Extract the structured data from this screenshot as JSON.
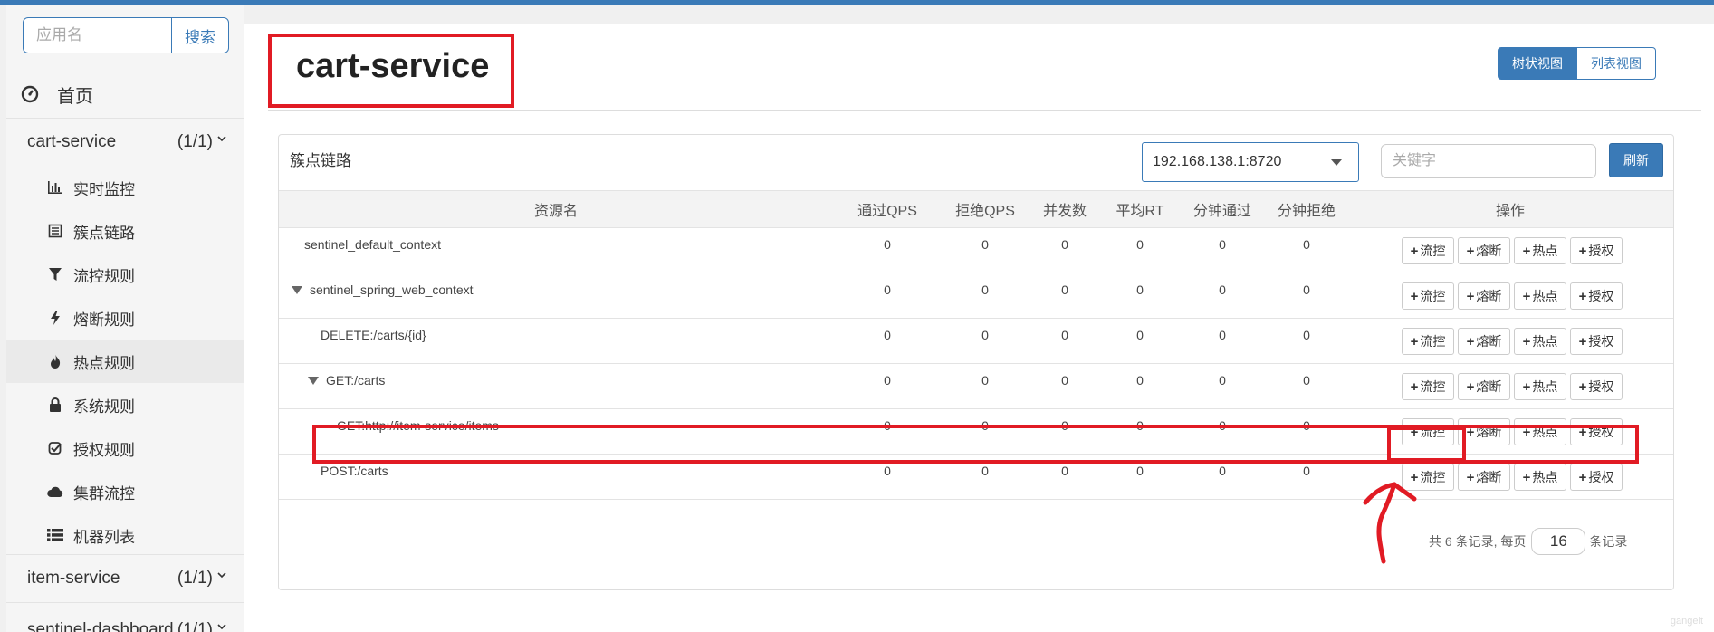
{
  "sidebar": {
    "search_placeholder": "应用名",
    "search_button": "搜索",
    "home_label": "首页",
    "apps": [
      {
        "name": "cart-service",
        "count": "(1/1)"
      },
      {
        "name": "item-service",
        "count": "(1/1)"
      },
      {
        "name": "sentinel-dashboard",
        "count": "(1/1)"
      }
    ],
    "menu": [
      {
        "label": "实时监控",
        "icon": "bar-chart-icon"
      },
      {
        "label": "簇点链路",
        "icon": "list-icon"
      },
      {
        "label": "流控规则",
        "icon": "filter-icon"
      },
      {
        "label": "熔断规则",
        "icon": "bolt-icon"
      },
      {
        "label": "热点规则",
        "icon": "fire-icon"
      },
      {
        "label": "系统规则",
        "icon": "lock-icon"
      },
      {
        "label": "授权规则",
        "icon": "check-square-icon"
      },
      {
        "label": "集群流控",
        "icon": "cloud-icon"
      },
      {
        "label": "机器列表",
        "icon": "list-ul-icon"
      }
    ]
  },
  "main": {
    "title": "cart-service",
    "views": {
      "tree": "树状视图",
      "list": "列表视图"
    },
    "panel_title": "簇点链路",
    "machine": "192.168.138.1:8720",
    "keyword_placeholder": "关键字",
    "refresh": "刷新"
  },
  "table": {
    "headers": {
      "resource": "资源名",
      "pass_qps": "通过QPS",
      "block_qps": "拒绝QPS",
      "concurrency": "并发数",
      "avg_rt": "平均RT",
      "min_pass": "分钟通过",
      "min_block": "分钟拒绝",
      "ops": "操作"
    },
    "op_labels": {
      "flow": "流控",
      "degrade": "熔断",
      "hot": "热点",
      "auth": "授权"
    },
    "rows": [
      {
        "name": "sentinel_default_context",
        "pass": "0",
        "block": "0",
        "conc": "0",
        "rt": "0",
        "mpass": "0",
        "mblock": "0"
      },
      {
        "name": "sentinel_spring_web_context",
        "pass": "0",
        "block": "0",
        "conc": "0",
        "rt": "0",
        "mpass": "0",
        "mblock": "0"
      },
      {
        "name": "DELETE:/carts/{id}",
        "pass": "0",
        "block": "0",
        "conc": "0",
        "rt": "0",
        "mpass": "0",
        "mblock": "0"
      },
      {
        "name": "GET:/carts",
        "pass": "0",
        "block": "0",
        "conc": "0",
        "rt": "0",
        "mpass": "0",
        "mblock": "0"
      },
      {
        "name": "GET:http://item-service/items",
        "pass": "0",
        "block": "0",
        "conc": "0",
        "rt": "0",
        "mpass": "0",
        "mblock": "0"
      },
      {
        "name": "POST:/carts",
        "pass": "0",
        "block": "0",
        "conc": "0",
        "rt": "0",
        "mpass": "0",
        "mblock": "0"
      }
    ]
  },
  "pager": {
    "prefix": "共 6 条记录, 每页",
    "page_size": "16",
    "suffix": "条记录"
  },
  "watermark": "gangeit",
  "colors": {
    "accent": "#3a7ab7",
    "annotation": "#e11b24"
  }
}
